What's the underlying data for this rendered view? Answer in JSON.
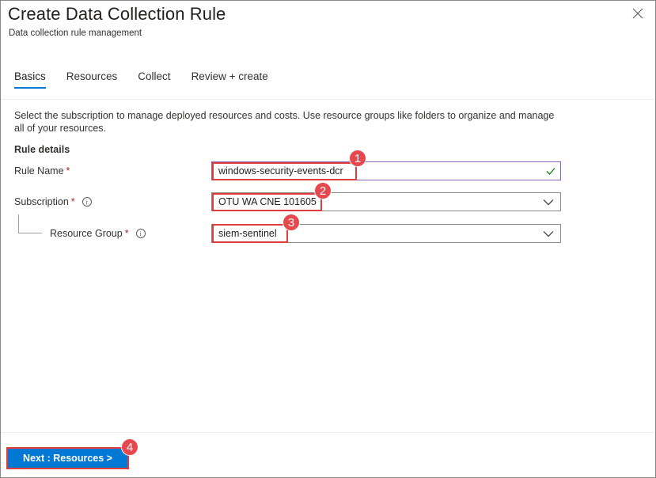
{
  "panel": {
    "title": "Create Data Collection Rule",
    "subtitle": "Data collection rule management",
    "close_icon": "close-icon"
  },
  "tabs": [
    {
      "label": "Basics",
      "active": true
    },
    {
      "label": "Resources",
      "active": false
    },
    {
      "label": "Collect",
      "active": false
    },
    {
      "label": "Review + create",
      "active": false
    }
  ],
  "description": "Select the subscription to manage deployed resources and costs. Use resource groups like folders to organize and manage all of your resources.",
  "section_title": "Rule details",
  "fields": {
    "rule_name": {
      "label": "Rule Name",
      "required_mark": "*",
      "value": "windows-security-events-dcr",
      "status_icon": "checkmark-icon",
      "badge": "1"
    },
    "subscription": {
      "label": "Subscription",
      "required_mark": "*",
      "value": "OTU WA CNE 101605",
      "info_icon": "info-icon",
      "badge": "2"
    },
    "resource_group": {
      "label": "Resource Group",
      "required_mark": "*",
      "value": "siem-sentinel",
      "info_icon": "info-icon",
      "badge": "3"
    }
  },
  "info_glyph": "i",
  "footer": {
    "next_label": "Next : Resources >",
    "badge": "4"
  },
  "colors": {
    "accent": "#0078d4",
    "highlight": "#e03c3c",
    "badge": "#e5484d",
    "required": "#a4262c",
    "valid_check": "#107c10"
  }
}
